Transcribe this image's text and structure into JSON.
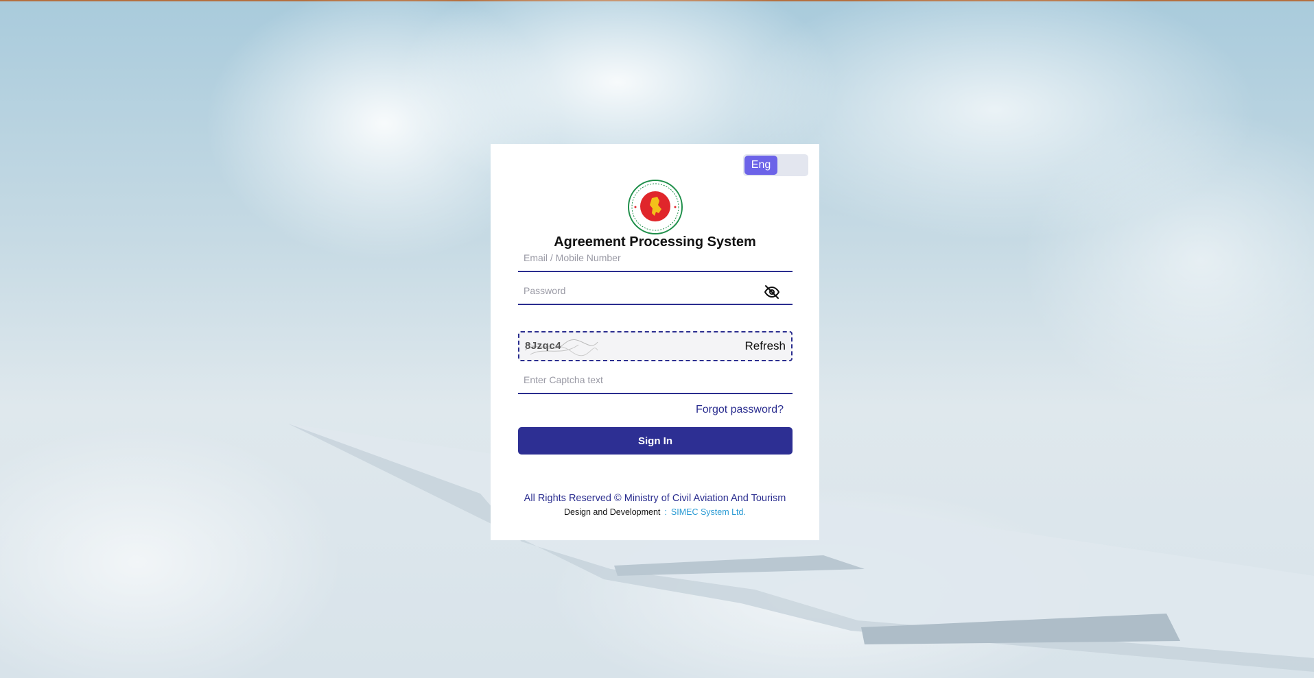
{
  "app": {
    "title": "Agreement Processing System"
  },
  "language_toggle": {
    "active_label": "Eng"
  },
  "login_form": {
    "email_placeholder": "Email / Mobile Number",
    "password_placeholder": "Password",
    "captcha_code": "8Jzqc4",
    "captcha_refresh_label": "Refresh",
    "captcha_placeholder": "Enter Captcha text",
    "forgot_password_label": "Forgot password?",
    "sign_in_label": "Sign In"
  },
  "footer": {
    "copyright": "All Rights Reserved © Ministry of Civil Aviation And Tourism",
    "credit_label": "Design and Development",
    "credit_separator": ":",
    "credit_company": "SIMEC System Ltd."
  },
  "colors": {
    "primary": "#2d2f93",
    "toggle_active": "#6c63e8",
    "link_light": "#2a9bd4",
    "emblem_green": "#1f8f4a",
    "emblem_red": "#e0262b"
  },
  "icons": {
    "password_visibility": "eye-off-icon",
    "emblem": "government-emblem"
  }
}
